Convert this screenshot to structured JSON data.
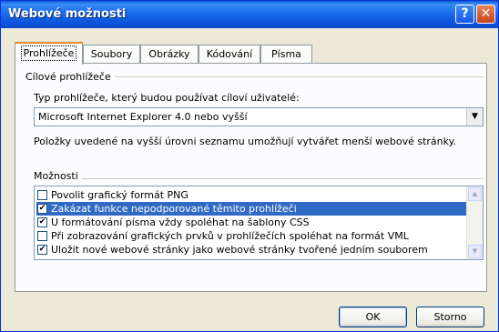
{
  "window": {
    "title": "Webové možnosti"
  },
  "titlebar_buttons": {
    "help": "?",
    "close": "✕"
  },
  "tabs": [
    {
      "label": "Prohlížeče",
      "active": true
    },
    {
      "label": "Soubory"
    },
    {
      "label": "Obrázky"
    },
    {
      "label": "Kódování"
    },
    {
      "label": "Písma"
    }
  ],
  "target_browsers": {
    "group_label": "Cílové prohlížeče",
    "type_label": "Typ prohlížeče, který budou používat cíloví uživatelé:",
    "selected_value": "Microsoft Internet Explorer 4.0 nebo vyšší",
    "note": "Položky uvedené na vyšší úrovni seznamu umožňují vytvářet menší webové stránky."
  },
  "options": {
    "group_label": "Možnosti",
    "items": [
      {
        "label": "Povolit grafický formát PNG",
        "checked": false
      },
      {
        "label": "Zakázat funkce nepodporované těmito prohlížeči",
        "checked": true,
        "selected": true
      },
      {
        "label": "U formátování písma vždy spoléhat na šablony CSS",
        "checked": true
      },
      {
        "label": "Při zobrazování grafických prvků v prohlížečích spoléhat na formát VML",
        "checked": false
      },
      {
        "label": "Uložit nové webové stránky jako webové stránky tvořené jedním souborem",
        "checked": true
      }
    ]
  },
  "buttons": {
    "ok": "OK",
    "cancel": "Storno"
  }
}
